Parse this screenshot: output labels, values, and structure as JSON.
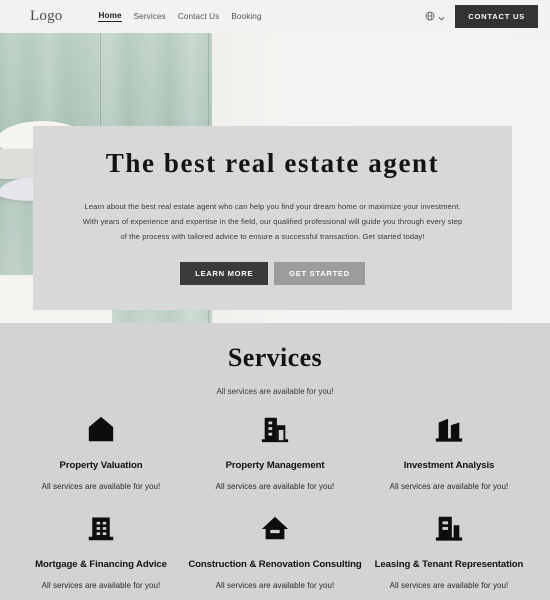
{
  "header": {
    "logo": "Logo",
    "nav": [
      {
        "label": "Home",
        "active": true
      },
      {
        "label": "Services",
        "active": false
      },
      {
        "label": "Contact Us",
        "active": false
      },
      {
        "label": "Booking",
        "active": false
      }
    ],
    "language_icon": "globe-icon",
    "chevron_icon": "chevron-down-icon",
    "contact_button": "CONTACT US"
  },
  "hero": {
    "title": "The best real estate agent",
    "paragraph": "Learn about the best real estate agent who can help you find your dream home or maximize your investment. With years of experience and expertise in the field, our qualified professional will guide you through every step of the process with tailored advice to ensure a successful transaction. Get started today!",
    "primary_button": "LEARN MORE",
    "secondary_button": "GET STARTED"
  },
  "services": {
    "title": "Services",
    "subtitle": "All services are available for you!",
    "items": [
      {
        "icon": "house-icon",
        "name": "Property Valuation",
        "desc": "All services are available for you!"
      },
      {
        "icon": "office-building-icon",
        "name": "Property Management",
        "desc": "All services are available for you!"
      },
      {
        "icon": "two-towers-icon",
        "name": "Investment Analysis",
        "desc": "All services are available for you!"
      },
      {
        "icon": "apartment-icon",
        "name": "Mortgage & Financing Advice",
        "desc": "All services are available for you!"
      },
      {
        "icon": "house-slot-icon",
        "name": "Construction & Renovation Consulting",
        "desc": "All services are available for you!"
      },
      {
        "icon": "building-tower-icon",
        "name": "Leasing & Tenant Representation",
        "desc": "All services are available for you!"
      }
    ]
  },
  "colors": {
    "page_bg": "#f2f2f1",
    "card_bg": "#d8d8d8",
    "services_bg": "#d3d3d3",
    "dark": "#333331",
    "grey_button": "#9c9c9c",
    "photo_accent": "#a9c2b6"
  }
}
